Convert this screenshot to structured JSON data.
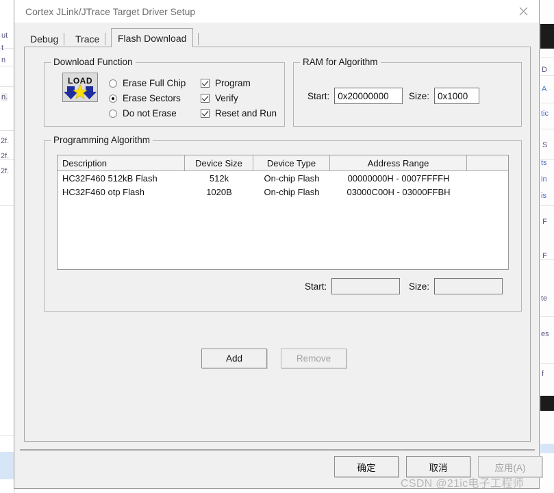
{
  "window": {
    "title": "Cortex JLink/JTrace Target Driver Setup",
    "close_icon": "close-icon"
  },
  "tabs": [
    {
      "label": "Debug",
      "active": false
    },
    {
      "label": "Trace",
      "active": false
    },
    {
      "label": "Flash Download",
      "active": true
    }
  ],
  "download_function": {
    "legend": "Download Function",
    "icon": "load-icon",
    "icon_text": "LOAD",
    "erase_options": [
      {
        "label": "Erase Full Chip",
        "selected": false
      },
      {
        "label": "Erase Sectors",
        "selected": true
      },
      {
        "label": "Do not Erase",
        "selected": false
      }
    ],
    "checkboxes": [
      {
        "label": "Program",
        "checked": true
      },
      {
        "label": "Verify",
        "checked": true
      },
      {
        "label": "Reset and Run",
        "checked": true
      }
    ]
  },
  "ram_for_algorithm": {
    "legend": "RAM for Algorithm",
    "start_label": "Start:",
    "start_value": "0x20000000",
    "size_label": "Size:",
    "size_value": "0x1000"
  },
  "programming_algorithm": {
    "legend": "Programming Algorithm",
    "columns": [
      "Description",
      "Device Size",
      "Device Type",
      "Address Range",
      ""
    ],
    "rows": [
      {
        "description": "HC32F460 512kB Flash",
        "device_size": "512k",
        "device_type": "On-chip Flash",
        "address_range": "00000000H - 0007FFFFH"
      },
      {
        "description": "HC32F460 otp Flash",
        "device_size": "1020B",
        "device_type": "On-chip Flash",
        "address_range": "03000C00H - 03000FFBH"
      }
    ],
    "start_label": "Start:",
    "start_value": "",
    "size_label": "Size:",
    "size_value": ""
  },
  "actions": {
    "add_label": "Add",
    "remove_label": "Remove",
    "remove_disabled": true
  },
  "footer": {
    "ok_label": "确定",
    "cancel_label": "取消",
    "apply_label": "应用(A)",
    "apply_disabled": true
  },
  "watermark": "CSDN @21ic电子工程师",
  "background_fragments": {
    "left": [
      "ut",
      "t",
      "n",
      "n.",
      "2f.",
      "2f.",
      "2f."
    ],
    "right": [
      "D",
      "A",
      "tic",
      "S",
      "ts",
      "in",
      "is",
      "F",
      "F",
      "te",
      "es",
      "f"
    ]
  },
  "colors": {
    "dialog_bg": "#f0f0f0",
    "titlebar_bg": "#ffffff",
    "title_text": "#6e6e6e",
    "group_border": "#b4b4b4",
    "table_bg": "#ffffff",
    "header_bg": "#f3f3f3",
    "disabled_text": "#a3a3a3",
    "watermark": "#b8b8b8",
    "load_icon_arrow": "#1f2d9e",
    "load_icon_star": "#ffe000"
  }
}
